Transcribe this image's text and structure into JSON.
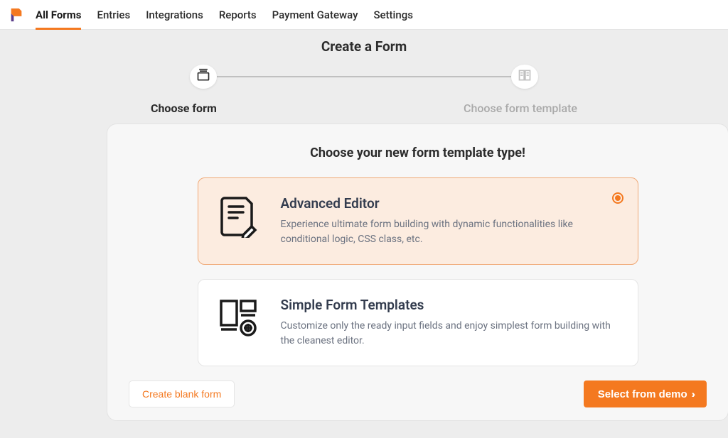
{
  "nav": {
    "items": [
      {
        "label": "All Forms",
        "active": true
      },
      {
        "label": "Entries",
        "active": false
      },
      {
        "label": "Integrations",
        "active": false
      },
      {
        "label": "Reports",
        "active": false
      },
      {
        "label": "Payment Gateway",
        "active": false
      },
      {
        "label": "Settings",
        "active": false
      }
    ]
  },
  "page": {
    "title": "Create a Form"
  },
  "stepper": {
    "step1_label": "Choose form",
    "step2_label": "Choose form template"
  },
  "panel": {
    "title": "Choose your new form template type!"
  },
  "options": {
    "advanced": {
      "title": "Advanced Editor",
      "desc": "Experience ultimate form building with dynamic functionalities like conditional logic, CSS class, etc.",
      "selected": true
    },
    "simple": {
      "title": "Simple Form Templates",
      "desc": "Customize only the ready input fields and enjoy simplest form building with the cleanest editor.",
      "selected": false
    }
  },
  "actions": {
    "blank_label": "Create blank form",
    "demo_label": "Select from demo"
  }
}
